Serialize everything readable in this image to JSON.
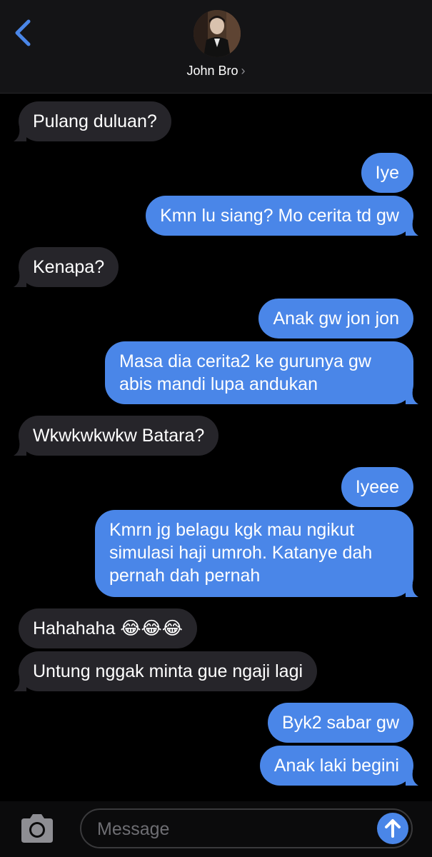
{
  "header": {
    "back_icon": "chevron-left-icon",
    "contact_name": "John Bro",
    "contact_chevron": "›",
    "accent_color": "#4a86e8"
  },
  "messages": [
    {
      "direction": "in",
      "text": "Pulang duluan?"
    },
    {
      "direction": "out",
      "text": "Iye"
    },
    {
      "direction": "out",
      "text": "Kmn lu siang? Mo cerita td gw"
    },
    {
      "direction": "in",
      "text": "Kenapa?"
    },
    {
      "direction": "out",
      "text": "Anak gw jon jon"
    },
    {
      "direction": "out",
      "text": "Masa dia cerita2 ke gurunya gw abis mandi lupa andukan"
    },
    {
      "direction": "in",
      "text": "Wkwkwkwkw Batara?"
    },
    {
      "direction": "out",
      "text": "Iyeee"
    },
    {
      "direction": "out",
      "text": "Kmrn jg belagu kgk mau ngikut simulasi haji umroh. Katanye dah pernah dah pernah"
    },
    {
      "direction": "in",
      "text": "Hahahaha 😂😂😂"
    },
    {
      "direction": "in",
      "text": "Untung nggak minta gue ngaji lagi"
    },
    {
      "direction": "out",
      "text": "Byk2 sabar gw"
    },
    {
      "direction": "out",
      "text": "Anak laki begini"
    }
  ],
  "composer": {
    "camera_icon": "camera-icon",
    "placeholder": "Message",
    "send_icon": "arrow-up-icon"
  },
  "colors": {
    "incoming_bubble": "#26252a",
    "outgoing_bubble": "#4a86e8",
    "background": "#000000"
  }
}
